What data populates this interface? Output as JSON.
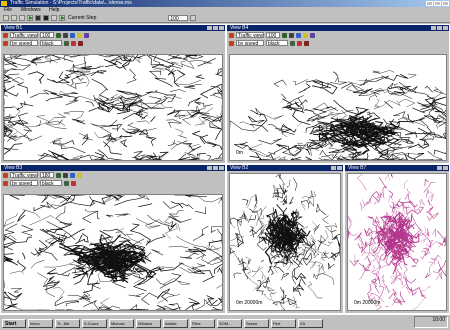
{
  "app": {
    "title": "Traffic Simulation - S:\\Projects\\Traffic\\data\\...\\dense.ms"
  },
  "menu": [
    "File",
    "Windows",
    "Help"
  ],
  "toolbar": {
    "step_label": "Current Step",
    "step_value": "100"
  },
  "views": [
    {
      "key": "v1",
      "title": "View B1",
      "mode": "Traffic view",
      "zoom": "100",
      "color_by": "by speed",
      "color": "black",
      "scale": ""
    },
    {
      "key": "v4",
      "title": "View B4",
      "mode": "Traffic view",
      "zoom": "100",
      "color_by": "by speed",
      "color": "black",
      "scale": "0m"
    },
    {
      "key": "v3",
      "title": "View B3",
      "mode": "Traffic view",
      "zoom": "180",
      "color_by": "by speed",
      "color": "black",
      "scale": ""
    },
    {
      "key": "v2",
      "title": "View B2",
      "mode": "",
      "zoom": "",
      "color_by": "",
      "color": "",
      "scale": "0m   20000m"
    },
    {
      "key": "v7",
      "title": "View B7",
      "mode": "",
      "zoom": "",
      "color_by": "",
      "color": "",
      "scale": "0m   20000m"
    }
  ],
  "map_colors": {
    "default": "#111111",
    "pink": "#b4368c"
  },
  "taskbar": {
    "start": "Start",
    "tasks": [
      "Inbox",
      "Tr...Me",
      "S.Cours",
      "Microsc",
      "Window",
      "Adobe",
      "Files",
      "SOM...",
      "Scene",
      "Perf",
      "Cit"
    ],
    "clock": "10:00"
  }
}
